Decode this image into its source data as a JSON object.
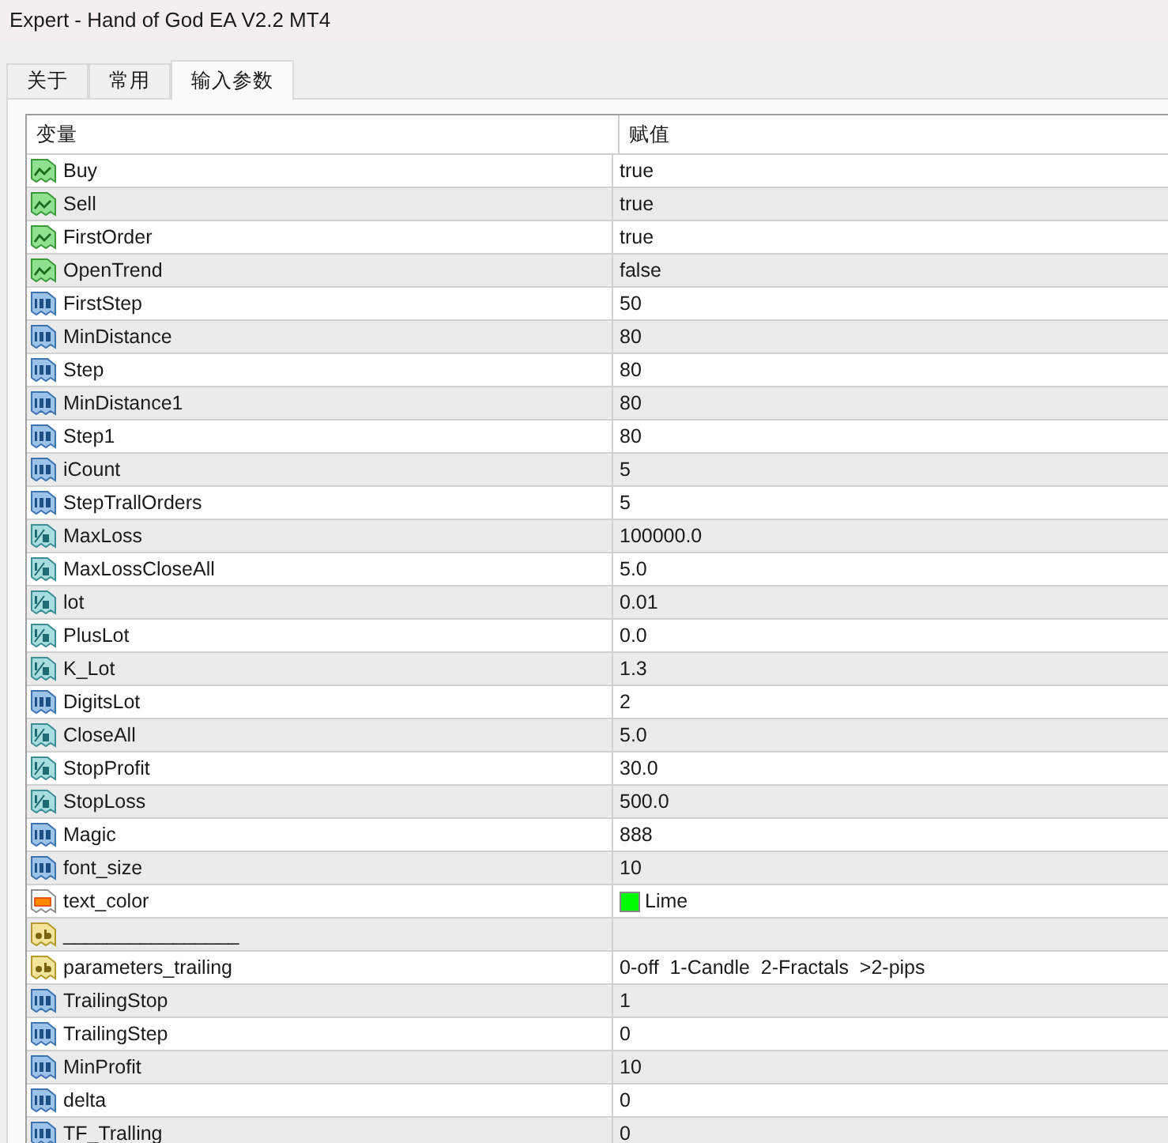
{
  "window": {
    "title": "Expert - Hand of God EA V2.2 MT4"
  },
  "tabs": [
    {
      "label": "关于",
      "selected": false
    },
    {
      "label": "常用",
      "selected": false
    },
    {
      "label": "输入参数",
      "selected": true
    }
  ],
  "table": {
    "columns": [
      "变量",
      "赋值"
    ],
    "rows": [
      {
        "kind": "bool",
        "name": "Buy",
        "value": "true"
      },
      {
        "kind": "bool",
        "name": "Sell",
        "value": "true"
      },
      {
        "kind": "bool",
        "name": "FirstOrder",
        "value": "true"
      },
      {
        "kind": "bool",
        "name": "OpenTrend",
        "value": "false"
      },
      {
        "kind": "int",
        "name": "FirstStep",
        "value": "50"
      },
      {
        "kind": "int",
        "name": "MinDistance",
        "value": "80"
      },
      {
        "kind": "int",
        "name": "Step",
        "value": "80"
      },
      {
        "kind": "int",
        "name": "MinDistance1",
        "value": "80"
      },
      {
        "kind": "int",
        "name": "Step1",
        "value": "80"
      },
      {
        "kind": "int",
        "name": "iCount",
        "value": "5"
      },
      {
        "kind": "int",
        "name": "StepTrallOrders",
        "value": "5"
      },
      {
        "kind": "double",
        "name": "MaxLoss",
        "value": "100000.0"
      },
      {
        "kind": "double",
        "name": "MaxLossCloseAll",
        "value": "5.0"
      },
      {
        "kind": "double",
        "name": "lot",
        "value": "0.01"
      },
      {
        "kind": "double",
        "name": "PlusLot",
        "value": "0.0"
      },
      {
        "kind": "double",
        "name": "K_Lot",
        "value": "1.3"
      },
      {
        "kind": "int",
        "name": "DigitsLot",
        "value": "2"
      },
      {
        "kind": "double",
        "name": "CloseAll",
        "value": "5.0"
      },
      {
        "kind": "double",
        "name": "StopProfit",
        "value": "30.0"
      },
      {
        "kind": "double",
        "name": "StopLoss",
        "value": "500.0"
      },
      {
        "kind": "int",
        "name": "Magic",
        "value": "888"
      },
      {
        "kind": "int",
        "name": "font_size",
        "value": "10"
      },
      {
        "kind": "color",
        "name": "text_color",
        "value": "Lime",
        "color": "#00ff00"
      },
      {
        "kind": "string",
        "name": "________________"
      },
      {
        "kind": "string",
        "name": "parameters_trailing",
        "value": "0-off  1-Candle  2-Fractals  >2-pips"
      },
      {
        "kind": "int",
        "name": "TrailingStop",
        "value": "1"
      },
      {
        "kind": "int",
        "name": "TrailingStep",
        "value": "0"
      },
      {
        "kind": "int",
        "name": "MinProfit",
        "value": "10"
      },
      {
        "kind": "int",
        "name": "delta",
        "value": "0"
      },
      {
        "kind": "int",
        "name": "TF_Tralling",
        "value": "0"
      }
    ]
  }
}
